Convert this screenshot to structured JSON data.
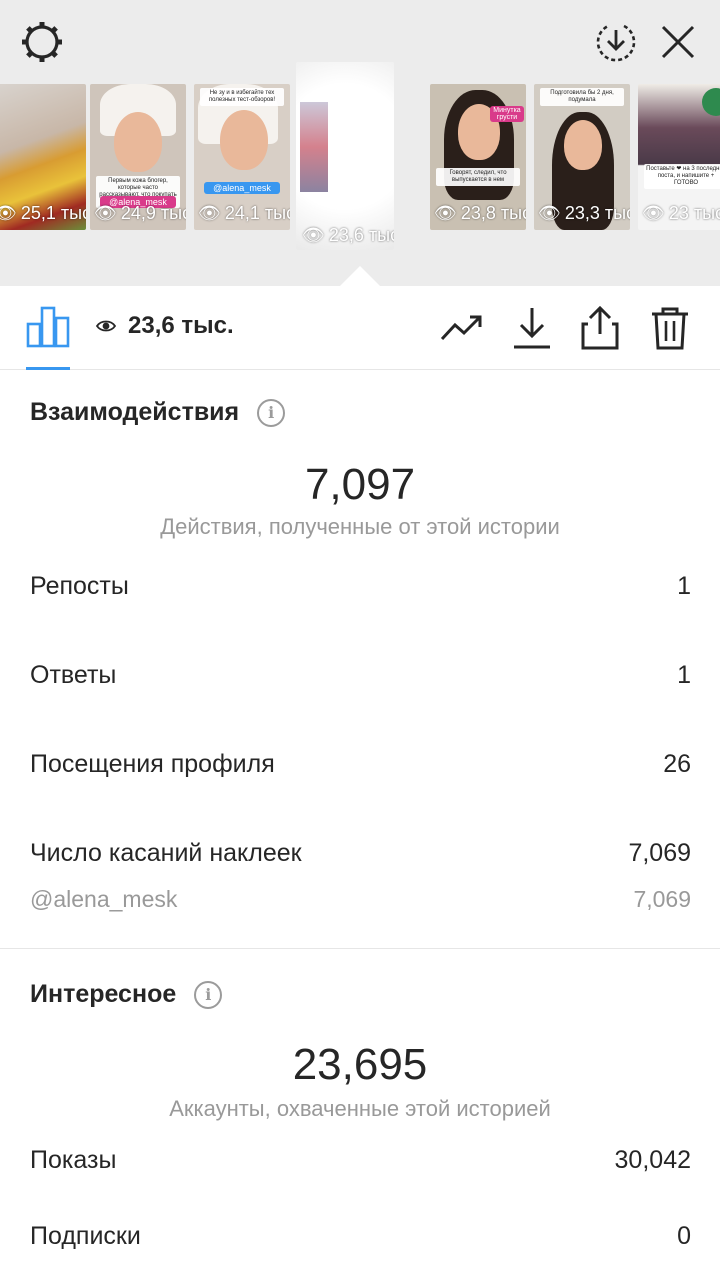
{
  "header": {
    "settings_icon": "gear-icon",
    "download_all_icon": "download-circle-icon",
    "close_icon": "close-icon"
  },
  "thumbnails": [
    {
      "views": "25,1 тыс."
    },
    {
      "views": "24,9 тыс.",
      "caption": "Первым кожа блогер, которые часто рассказывают, что покупать НЕ НАДО!",
      "tag": "@alena_mesk"
    },
    {
      "views": "24,1 тыс.",
      "caption": "Не зу и в избегайте тех полезных тест-обзоров!",
      "tag": "@alena_mesk"
    },
    {
      "views": "23,6 тыс.",
      "selected": true
    },
    {
      "views": "23,8 тыс.",
      "caption": "Говорят, следил, что выпускается в нем",
      "tag": "Минутка грусти"
    },
    {
      "views": "23,3 тыс.",
      "caption": "Подготовила бы 2 дня, подумала"
    },
    {
      "views": "23 тыс.",
      "caption": "Поставьте ❤ на 3 последних поста, и напишите + ГОТОВО"
    }
  ],
  "toolbar": {
    "views": "23,6 тыс.",
    "icons": [
      "bar-chart-icon",
      "eye-icon",
      "trend-icon",
      "download-icon",
      "share-icon",
      "trash-icon"
    ]
  },
  "interactions": {
    "title": "Взаимодействия",
    "total": "7,097",
    "caption": "Действия, полученные от этой истории",
    "rows": [
      {
        "label": "Репосты",
        "value": "1"
      },
      {
        "label": "Ответы",
        "value": "1"
      },
      {
        "label": "Посещения профиля",
        "value": "26"
      },
      {
        "label": "Число касаний наклеек",
        "value": "7,069"
      }
    ],
    "sub_row": {
      "label": "@alena_mesk",
      "value": "7,069"
    }
  },
  "discovery": {
    "title": "Интересное",
    "total": "23,695",
    "caption": "Аккаунты, охваченные этой историей",
    "rows": [
      {
        "label": "Показы",
        "value": "30,042"
      },
      {
        "label": "Подписки",
        "value": "0"
      }
    ]
  },
  "colors": {
    "accent": "#3897f0",
    "text": "#262626",
    "muted": "#999999",
    "top_background": "#ececec"
  }
}
